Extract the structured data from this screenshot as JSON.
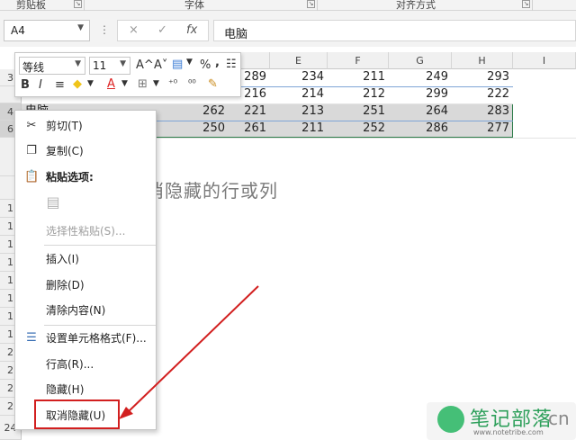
{
  "ribbon": {
    "groups": [
      {
        "label": "剪贴板"
      },
      {
        "label": "字体"
      },
      {
        "label": "对齐方式"
      }
    ]
  },
  "formula_bar": {
    "name_box": "A4",
    "cancel_symbol": "×",
    "enter_symbol": "✓",
    "fx_symbol": "fx",
    "content": "电脑"
  },
  "sheet": {
    "columns": [
      "E",
      "F",
      "G",
      "H",
      "I"
    ],
    "rows": [
      {
        "label": "3",
        "cells": [
          "289",
          "234",
          "211",
          "249",
          "293"
        ]
      },
      {
        "label": "",
        "cells": [
          "216",
          "214",
          "212",
          "299",
          "222"
        ]
      },
      {
        "label": "4",
        "a_cell": "电脑",
        "cells": [
          "262",
          "221",
          "213",
          "251",
          "264",
          "283"
        ]
      },
      {
        "label": "6",
        "cells": [
          "250",
          "261",
          "211",
          "252",
          "286",
          "277"
        ]
      }
    ],
    "left_row_numbers": [
      "1",
      "1",
      "1",
      "1",
      "1",
      "1",
      "1",
      "1",
      "2",
      "2",
      "2",
      "2",
      "24"
    ],
    "ghost_text": "消隐藏的行或列"
  },
  "mini_toolbar": {
    "font_name": "等线",
    "font_size": "11",
    "increase_font": "A^",
    "decrease_font": "A˅",
    "percent": "%",
    "comma": ",",
    "bold": "B",
    "italic": "I"
  },
  "context_menu": {
    "items": [
      {
        "label": "剪切(T)",
        "icon": "scissors-icon"
      },
      {
        "label": "复制(C)",
        "icon": "copy-icon"
      },
      {
        "label": "粘贴选项:",
        "icon": "paste-icon"
      },
      {
        "label": "选择性粘贴(S)...",
        "disabled": true
      },
      {
        "label": "插入(I)"
      },
      {
        "label": "删除(D)"
      },
      {
        "label": "清除内容(N)"
      },
      {
        "label": "设置单元格格式(F)...",
        "icon": "format-cells-icon"
      },
      {
        "label": "行高(R)..."
      },
      {
        "label": "隐藏(H)"
      },
      {
        "label": "取消隐藏(U)"
      }
    ]
  },
  "watermark": {
    "brand": "笔记部落",
    "url": "www.notetribe.com",
    "suffix": "cn"
  },
  "colors": {
    "selection_border": "#2f7d4a",
    "highlight_red": "#d21f1f",
    "watermark_green": "#45bf77"
  }
}
